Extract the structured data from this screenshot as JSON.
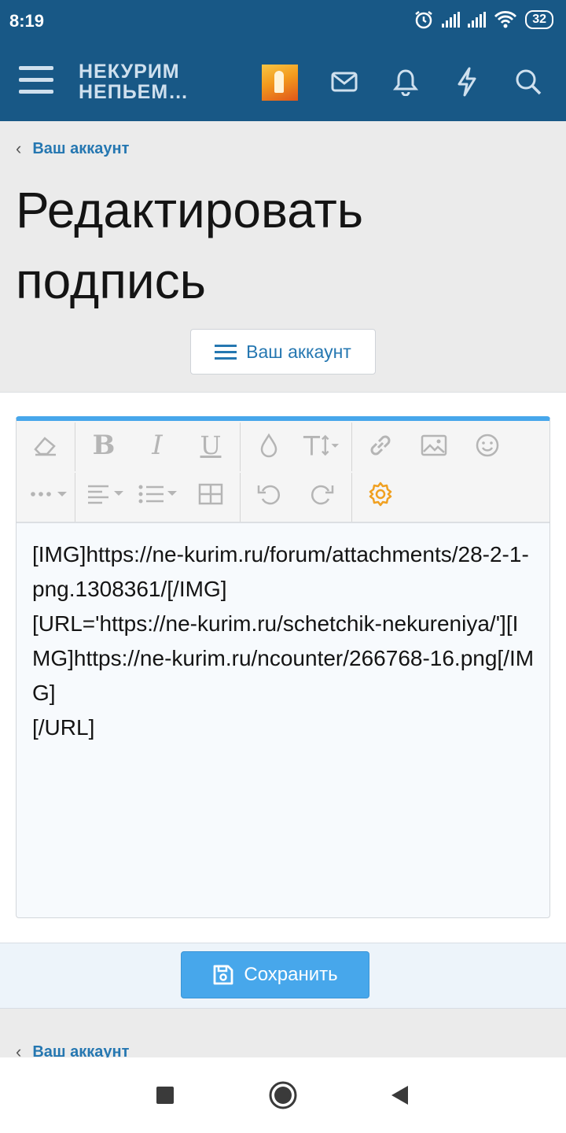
{
  "status_bar": {
    "time": "8:19",
    "battery": "32"
  },
  "header": {
    "logo_line1": "НЕКУРИМ",
    "logo_line2": "НЕПЬЕМ…"
  },
  "breadcrumb": {
    "label": "Ваш аккаунт"
  },
  "page_title": "Редактировать подпись",
  "account_menu_button": {
    "label": "Ваш аккаунт"
  },
  "editor": {
    "toolbar_icons": [
      "eraser-icon",
      "bold-icon",
      "italic-icon",
      "underline-icon",
      "color-drop-icon",
      "text-size-icon",
      "link-icon",
      "image-icon",
      "smiley-icon",
      "more-icon",
      "align-icon",
      "list-icon",
      "table-icon",
      "undo-icon",
      "redo-icon",
      "settings-icon"
    ],
    "content": "[IMG]https://ne-kurim.ru/forum/attachments/28-2-1-png.1308361/[/IMG]\n[URL='https://ne-kurim.ru/schetchik-nekureniya/'][IMG]https://ne-kurim.ru/ncounter/266768-16.png[/IMG]\n[/URL]"
  },
  "save_button": {
    "label": "Сохранить"
  },
  "footer_breadcrumb": {
    "label": "Ваш аккаунт"
  },
  "colors": {
    "header": "#185886",
    "link": "#2577b1",
    "accent": "#47a7eb",
    "settings_icon": "#f0a020"
  }
}
